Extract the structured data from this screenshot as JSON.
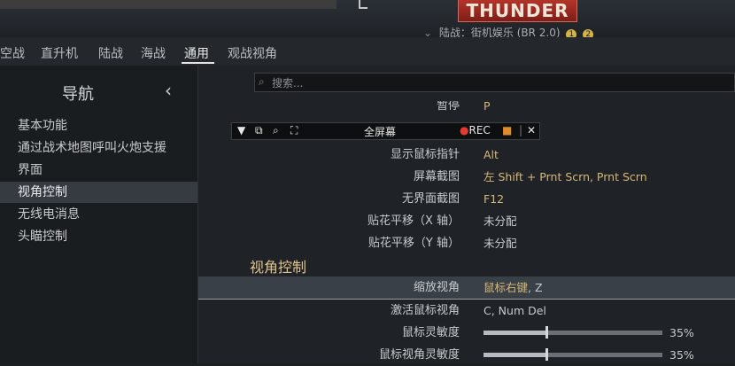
{
  "game": {
    "logo_text": "THUNDER",
    "mode_text": "陆战：街机娱乐 (BR 2.0)",
    "mode_badge_1": "1",
    "mode_badge_2": "2"
  },
  "tabs": [
    {
      "label": "空战"
    },
    {
      "label": "直升机"
    },
    {
      "label": "陆战"
    },
    {
      "label": "海战"
    },
    {
      "label": "通用",
      "active": true
    },
    {
      "label": "观战视角"
    }
  ],
  "sidebar": {
    "title": "导航",
    "back_icon": "chevron-left-icon",
    "items": [
      {
        "label": "基本功能"
      },
      {
        "label": "通过战术地图呼叫火炮支援"
      },
      {
        "label": "界面"
      },
      {
        "label": "视角控制",
        "active": true
      },
      {
        "label": "无线电消息"
      },
      {
        "label": "头瞄控制"
      }
    ]
  },
  "search": {
    "placeholder": "搜索..."
  },
  "recorder": {
    "fullscreen_label": "全屏幕",
    "rec_label": "REC",
    "separator": "|",
    "close_label": "✕"
  },
  "settings": {
    "partial_row": {
      "label": "暂停",
      "value": "P"
    },
    "rows": [
      {
        "label": "显示鼠标指针",
        "value": "Alt"
      },
      {
        "label": "屏幕截图",
        "value": "左 Shift + Prnt Scrn, Prnt Scrn"
      },
      {
        "label": "无界面截图",
        "value": "F12"
      },
      {
        "label": "贴花平移（X 轴）",
        "value": "未分配"
      },
      {
        "label": "贴花平移（Y 轴）",
        "value": "未分配"
      }
    ],
    "section_title": "视角控制",
    "camera_rows": [
      {
        "label": "缩放视角",
        "value_main": "鼠标右键",
        "value_extra": ", Z"
      },
      {
        "label": "激活鼠标视角",
        "value": "C, Num Del"
      }
    ],
    "sliders": [
      {
        "label": "鼠标灵敏度",
        "value": 0.35,
        "text": "35%"
      },
      {
        "label": "鼠标视角灵敏度",
        "value": 0.35,
        "text": "35%"
      }
    ]
  },
  "colors": {
    "accent_gold": "#d6b876",
    "section_gold": "#e0c28a",
    "highlight_row": "#3a4048",
    "rec_red": "#e23a2e"
  }
}
